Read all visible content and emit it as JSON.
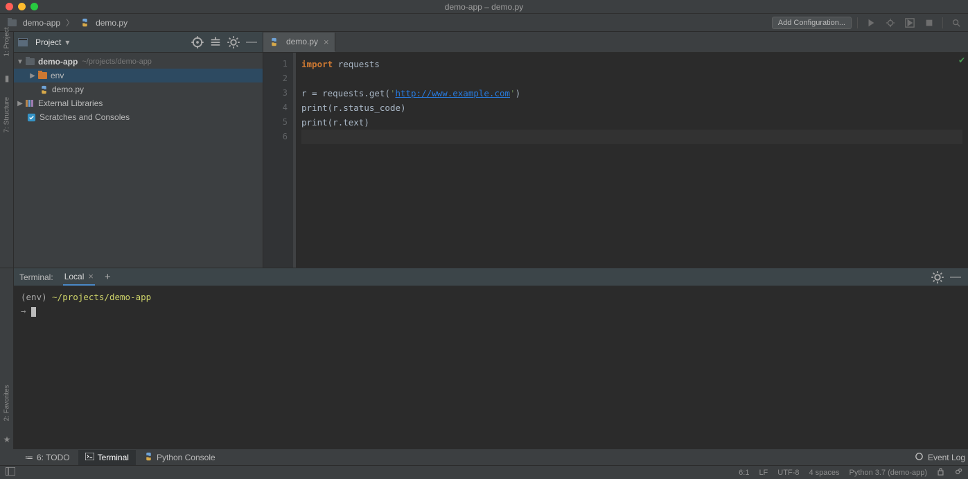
{
  "window_title": "demo-app – demo.py",
  "breadcrumb": {
    "project": "demo-app",
    "file": "demo.py"
  },
  "toolbar": {
    "add_config": "Add Configuration..."
  },
  "project_panel": {
    "title": "Project",
    "root": "demo-app",
    "root_path": "~/projects/demo-app",
    "env_folder": "env",
    "demo_file": "demo.py",
    "external": "External Libraries",
    "scratches": "Scratches and Consoles"
  },
  "editor": {
    "tab_label": "demo.py",
    "lines": [
      "1",
      "2",
      "3",
      "4",
      "5",
      "6"
    ],
    "code": {
      "l1_kw": "import",
      "l1_mod": "requests",
      "l3_pre": "r = requests.get(",
      "l3_q": "'",
      "l3_url": "http://www.example.com",
      "l3_post": ")",
      "l4_fn": "print",
      "l4_arg": "(r.status_code)",
      "l5_fn": "print",
      "l5_arg": "(r.text)"
    }
  },
  "terminal": {
    "title": "Terminal:",
    "tab": "Local",
    "prompt_env": "(env) ",
    "prompt_path": "~/projects/demo-app",
    "arrow": "→"
  },
  "bottom_tabs": {
    "todo": "6: TODO",
    "terminal": "Terminal",
    "py_console": "Python Console"
  },
  "event_log": "Event Log",
  "status": {
    "pos": "6:1",
    "eol": "LF",
    "enc": "UTF-8",
    "indent": "4 spaces",
    "interpreter": "Python 3.7 (demo-app)"
  },
  "left_rail": {
    "project": "1: Project",
    "structure": "7: Structure",
    "favorites": "2: Favorites"
  }
}
